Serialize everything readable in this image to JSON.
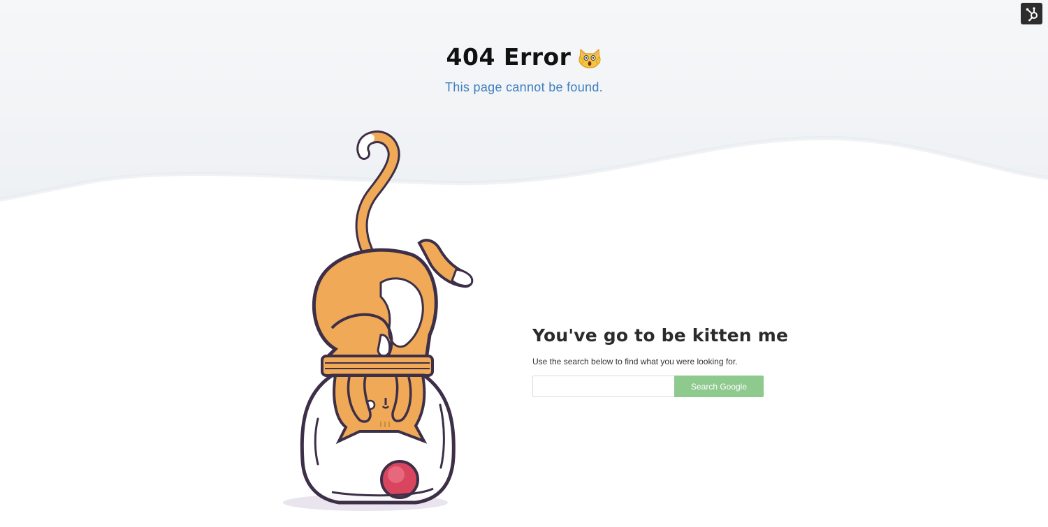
{
  "header": {
    "title": "404 Error",
    "emoji": "🙀",
    "subtitle": "This page cannot be found."
  },
  "main": {
    "heading": "You've go to be kitten me",
    "help_text": "Use the search below to find what you were looking for.",
    "search": {
      "value": "",
      "placeholder": "",
      "button_label": "Search Google"
    }
  },
  "icons": {
    "corner_badge": "hubspot-sprocket-icon",
    "illustration": "cat-in-jar-illustration"
  },
  "colors": {
    "subtitle": "#3f7fbf",
    "button": "#8ec98e",
    "wave_bg": "#f4f6f8",
    "cat_orange": "#f0a957",
    "ball": "#d9455f"
  }
}
